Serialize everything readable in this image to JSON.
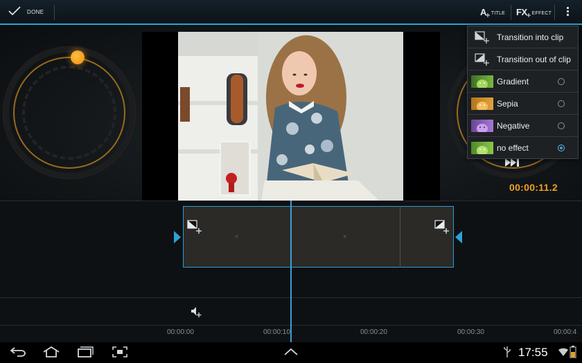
{
  "action_bar": {
    "done_label": "DONE",
    "title_button": {
      "glyph": "A",
      "label": "TITLE"
    },
    "effect_button": {
      "glyph": "FX",
      "label": "EFFECT"
    },
    "overflow_icon": "overflow-menu-icon"
  },
  "preview": {
    "timecode": "00:00:11.2"
  },
  "effect_menu": {
    "items": [
      {
        "label": "Transition into clip",
        "icon": "transition-in-icon"
      },
      {
        "label": "Transition out of clip",
        "icon": "transition-out-icon"
      },
      {
        "label": "Gradient",
        "thumb_color": "#5a8f2e",
        "selected": false
      },
      {
        "label": "Sepia",
        "thumb_color": "#c98a2a",
        "selected": false
      },
      {
        "label": "Negative",
        "thumb_color": "#8b5fb8",
        "selected": false
      },
      {
        "label": "no effect",
        "thumb_color": "#6aa33a",
        "selected": true
      }
    ]
  },
  "timeline": {
    "ticks": [
      "00:00:00",
      "00:00:10",
      "00:00:20",
      "00:00:30",
      "00:00:4"
    ]
  },
  "system_bar": {
    "time": "17:55"
  },
  "colors": {
    "accent": "#2aa3d6",
    "timecode": "#f0a020",
    "knob": "#f5a020"
  }
}
